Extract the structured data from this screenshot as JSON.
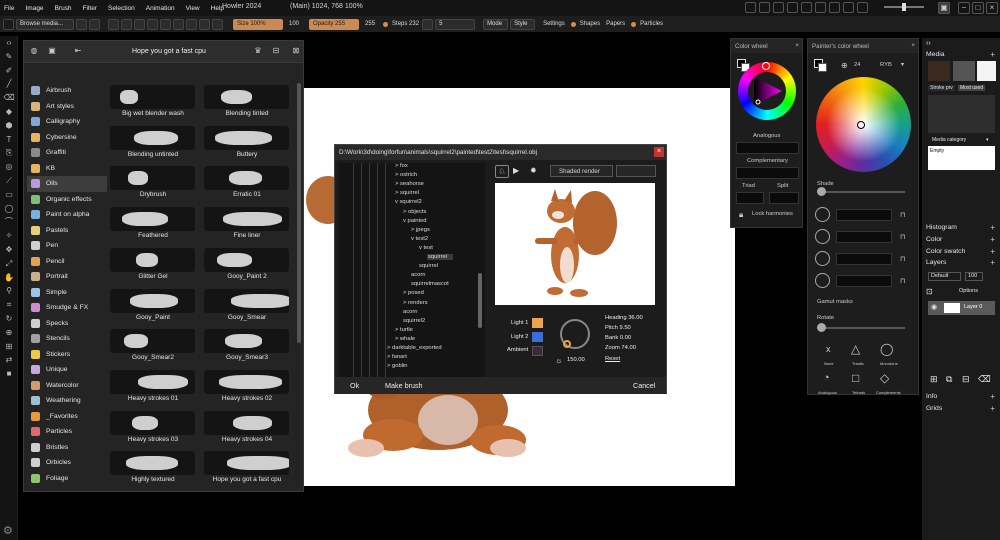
{
  "app": {
    "title": "Howler 2024",
    "coords": "(Main)  1024, 768  100%"
  },
  "menu": [
    "File",
    "Image",
    "Brush",
    "Filter",
    "Selection",
    "Animation",
    "View",
    "Help"
  ],
  "toolbar": {
    "browse": "Browse media...",
    "size_label": "Size 100%",
    "size_value": "100",
    "opacity_label": "Opacity 255",
    "opacity_value": "255",
    "steps_label": "Steps 232",
    "steps_value": "5",
    "mode": "Mode",
    "style": "Style",
    "settings": "Settings",
    "shapes": "Shapes",
    "papers": "Papers",
    "particles": "Particles"
  },
  "brush_panel": {
    "title": "Hope you got a fast cpu",
    "categories": [
      {
        "label": "Airbrush",
        "color": "#9aa9c8"
      },
      {
        "label": "Art styles",
        "color": "#d9b47a"
      },
      {
        "label": "Calligraphy",
        "color": "#7fa8d6"
      },
      {
        "label": "Cybersine",
        "color": "#e7b65a"
      },
      {
        "label": "Graffiti",
        "color": "#8a8a8a"
      },
      {
        "label": "KB",
        "color": "#e7b65a"
      },
      {
        "label": "Oils",
        "color": "#b79adb"
      },
      {
        "label": "Organic effects",
        "color": "#7dbf7a"
      },
      {
        "label": "Paint on alpha",
        "color": "#7ab0d9"
      },
      {
        "label": "Pastels",
        "color": "#e5d07a"
      },
      {
        "label": "Pen",
        "color": "#cfcfcf"
      },
      {
        "label": "Pencil",
        "color": "#e0a34f"
      },
      {
        "label": "Portrait",
        "color": "#c9b18e"
      },
      {
        "label": "Simple",
        "color": "#9fc4e8"
      },
      {
        "label": "Smudge & FX",
        "color": "#d08ad0"
      },
      {
        "label": "Specks",
        "color": "#cfcfcf"
      },
      {
        "label": "Stencils",
        "color": "#a0a0a0"
      },
      {
        "label": "Stickers",
        "color": "#f0c94a"
      },
      {
        "label": "Unique",
        "color": "#c8a8e0"
      },
      {
        "label": "Watercolor",
        "color": "#d89a6a"
      },
      {
        "label": "Weathering",
        "color": "#a0c0d0"
      },
      {
        "label": "_Favorites",
        "color": "#e89a3a"
      },
      {
        "label": "Particles",
        "color": "#e06a6a"
      },
      {
        "label": "Bristles",
        "color": "#cfcfcf"
      },
      {
        "label": "Orbicles",
        "color": "#cfcfcf"
      },
      {
        "label": "Foliage",
        "color": "#8fc46a"
      }
    ],
    "brushes": [
      "Big wet blender wash",
      "Blending tinted",
      "Blending untinted",
      "Buttery",
      "Drybrush",
      "Erratic 01",
      "Feathered",
      "Fine liner",
      "Glitter Gel",
      "Gooy_Paint 2",
      "Gooy_Paint",
      "Gooy_Smear",
      "Gooy_Smear2",
      "Gooy_Smear3",
      "Heavy strokes 01",
      "Heavy strokes 02",
      "Heavy strokes 03",
      "Heavy strokes 04",
      "Highly textured",
      "Hope you got a fast cpu"
    ]
  },
  "dialog": {
    "path": "D:\\Work\\3d\\doing\\forfun\\animals\\squirrel2\\painted\\test2\\test\\squirrel.obj",
    "render_mode": "Shaded render",
    "tree": [
      {
        "label": "fox",
        "level": 0,
        "arrow": ">"
      },
      {
        "label": "ostrich",
        "level": 0,
        "arrow": ">"
      },
      {
        "label": "seahorse",
        "level": 0,
        "arrow": ">"
      },
      {
        "label": "squirrel",
        "level": 0,
        "arrow": ">"
      },
      {
        "label": "squirrel2",
        "level": 0,
        "arrow": "v"
      },
      {
        "label": "objects",
        "level": 1,
        "arrow": ">"
      },
      {
        "label": "painted",
        "level": 1,
        "arrow": "v"
      },
      {
        "label": "jpegs",
        "level": 2,
        "arrow": ">"
      },
      {
        "label": "test2",
        "level": 2,
        "arrow": "v"
      },
      {
        "label": "test",
        "level": 3,
        "arrow": "v"
      },
      {
        "label": "squirrel",
        "level": 4,
        "arrow": "",
        "selected": true
      },
      {
        "label": "squirrel",
        "level": 3,
        "arrow": ""
      },
      {
        "label": "acorn",
        "level": 2,
        "arrow": ""
      },
      {
        "label": "squirrelmascot",
        "level": 2,
        "arrow": ""
      },
      {
        "label": "posed",
        "level": 1,
        "arrow": ">"
      },
      {
        "label": "renders",
        "level": 1,
        "arrow": ">"
      },
      {
        "label": "acorn",
        "level": 1,
        "arrow": ""
      },
      {
        "label": "squirrel2",
        "level": 1,
        "arrow": ""
      },
      {
        "label": "turtle",
        "level": 0,
        "arrow": ">"
      },
      {
        "label": "whale",
        "level": 0,
        "arrow": ">"
      },
      {
        "label": "darktable_exported",
        "level": -1,
        "arrow": ">"
      },
      {
        "label": "fanart",
        "level": -1,
        "arrow": ">"
      },
      {
        "label": "goblin",
        "level": -1,
        "arrow": ">"
      }
    ],
    "light1": "Light 1",
    "light2": "Light 2",
    "ambient": "Ambient",
    "light1_color": "#e8a54a",
    "light2_color": "#3a6fd8",
    "ambient_color": "#3b2a3a",
    "heading": "Heading 36.00",
    "pitch": "Pitch 9.50",
    "bank": "Bank 0.00",
    "zoom": "Zoom 74.00",
    "reset": "Reset",
    "sun_value": "150.00",
    "ok": "Ok",
    "make_brush": "Make brush",
    "cancel": "Cancel"
  },
  "color_wheel": {
    "title": "Color wheel",
    "analogous": "Analogous",
    "complementary": "Complementary",
    "triad": "Triad",
    "split": "Split",
    "lock": "Lock harmonies"
  },
  "painters_wheel": {
    "title": "Painter's color wheel",
    "count": "24",
    "model": "RYB",
    "shade": "Shade",
    "gamut": "Gamut masks",
    "rotate": "Rotate",
    "masks": [
      "None",
      "Triadic",
      "Monotone",
      "Analogous",
      "Tetrads",
      "Complements"
    ]
  },
  "right_panel": {
    "media": "Media",
    "tab1": "Stroke prv",
    "tab2": "Most used",
    "media_category": "Media category",
    "empty": "Empty",
    "histogram": "Histogram",
    "color": "Color",
    "color_swatch": "Color swatch",
    "layers": "Layers",
    "layer_mode": "Default",
    "layer_opacity": "100",
    "options": "Options",
    "layer_name": "Layer 0",
    "info": "Info",
    "grids": "Grids"
  }
}
